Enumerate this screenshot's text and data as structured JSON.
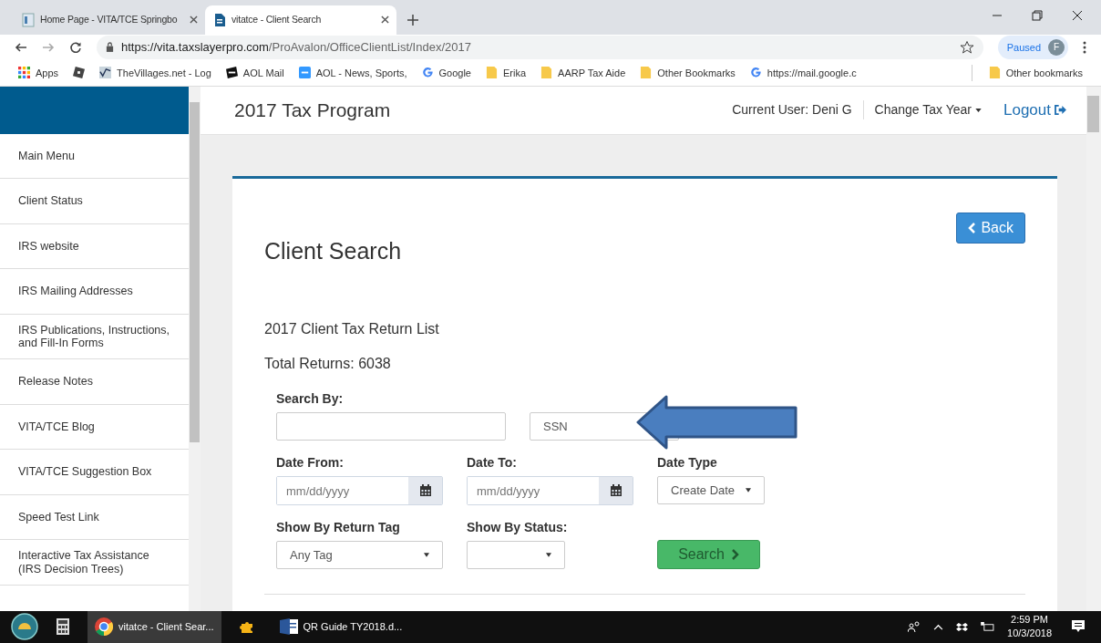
{
  "browser": {
    "tabs": [
      {
        "title": "Home Page - VITA/TCE Springbo",
        "kind": "doc",
        "selected": false
      },
      {
        "title": "vitatce - Client Search",
        "kind": "file",
        "selected": true
      }
    ],
    "url_host": "https://vita.taxslayerpro.com",
    "url_path": "/ProAvalon/OfficeClientList/Index/2017",
    "profile": {
      "label": "Paused",
      "initial": "F"
    },
    "bookmarks": [
      {
        "label": "Apps",
        "kind": "grid"
      },
      {
        "kind": "square"
      },
      {
        "label": "TheVillages.net - Log",
        "kind": "wave"
      },
      {
        "label": "AOL Mail",
        "kind": "aolblack"
      },
      {
        "label": "AOL - News, Sports,",
        "kind": "aolblue"
      },
      {
        "label": "Google",
        "kind": "google"
      },
      {
        "label": "Erika",
        "kind": "folder"
      },
      {
        "label": "AARP Tax Aide",
        "kind": "folder"
      },
      {
        "label": "Other Bookmarks",
        "kind": "folder"
      },
      {
        "label": "https://mail.google.c",
        "kind": "google"
      }
    ],
    "other_bookmarks": "Other bookmarks"
  },
  "header": {
    "title": "2017 Tax Program",
    "current_user": "Current User: Deni G",
    "change_year": "Change Tax Year",
    "logout": "Logout"
  },
  "sidebar": {
    "items": [
      {
        "label": "Main Menu"
      },
      {
        "label": "Client Status"
      },
      {
        "label": "IRS website"
      },
      {
        "label": "IRS Mailing Addresses"
      },
      {
        "label": "IRS Publications, Instructions, and Fill-In Forms"
      },
      {
        "label": "Release Notes"
      },
      {
        "label": "VITA/TCE Blog"
      },
      {
        "label": "VITA/TCE Suggestion Box"
      },
      {
        "label": "Speed Test Link"
      },
      {
        "label": "Interactive Tax Assistance (IRS Decision Trees)"
      }
    ]
  },
  "main": {
    "back": "Back",
    "title": "Client Search",
    "list_title": "2017 Client Tax Return List",
    "total": "Total Returns: 6038",
    "search_by": {
      "label": "Search By:",
      "type": "SSN"
    },
    "date_from": {
      "label": "Date From:",
      "placeholder": "mm/dd/yyyy"
    },
    "date_to": {
      "label": "Date To:",
      "placeholder": "mm/dd/yyyy"
    },
    "date_type": {
      "label": "Date Type",
      "value": "Create Date"
    },
    "return_tag": {
      "label": "Show By Return Tag",
      "value": "Any Tag"
    },
    "status": {
      "label": "Show By Status:"
    },
    "search": "Search"
  },
  "annotations": [
    {
      "kind": "arrow"
    }
  ],
  "taskbar": {
    "apps": [
      {
        "kind": "calculator"
      },
      {
        "kind": "chrome",
        "label": "vitatce - Client Sear...",
        "selected": true
      },
      {
        "kind": "puzzle"
      },
      {
        "kind": "word",
        "label": "QR Guide TY2018.d...",
        "selected": false
      }
    ],
    "time": "2:59 PM",
    "date": "10/3/2018"
  }
}
